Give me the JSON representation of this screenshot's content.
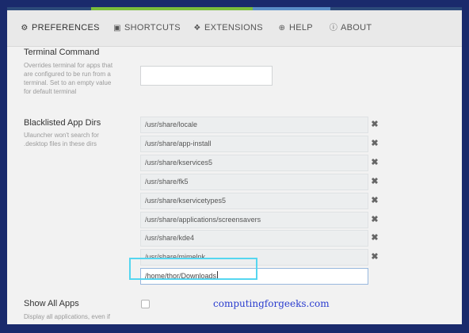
{
  "tabs": [
    {
      "label": "PREFERENCES",
      "icon": "gear-icon"
    },
    {
      "label": "SHORTCUTS",
      "icon": "shortcuts-icon"
    },
    {
      "label": "EXTENSIONS",
      "icon": "puzzle-icon"
    },
    {
      "label": "HELP",
      "icon": "lifebuoy-icon"
    },
    {
      "label": "ABOUT",
      "icon": "info-icon"
    }
  ],
  "terminal": {
    "title": "Terminal Command",
    "description": [
      "Overrides terminal for apps that",
      "are configured to be run from a",
      "terminal. Set to an empty value",
      "for default terminal"
    ],
    "value": ""
  },
  "blacklist": {
    "title": "Blacklisted App Dirs",
    "description": [
      "Ulauncher won't search for",
      ".desktop files in these dirs"
    ],
    "dirs": [
      "/usr/share/locale",
      "/usr/share/app-install",
      "/usr/share/kservices5",
      "/usr/share/fk5",
      "/usr/share/kservicetypes5",
      "/usr/share/applications/screensavers",
      "/usr/share/kde4",
      "/usr/share/mimelnk"
    ],
    "new_dir_value": "/home/thor/Downloads",
    "delete_symbol": "✖"
  },
  "show_all_apps": {
    "title": "Show All Apps",
    "description": "Display all applications, even if",
    "checked": false
  },
  "watermark": "computingforgeeks.com",
  "colors": {
    "frame_border": "#1a2a6c",
    "highlight": "#55d6f0",
    "accent_green": "#7bbd3c"
  }
}
